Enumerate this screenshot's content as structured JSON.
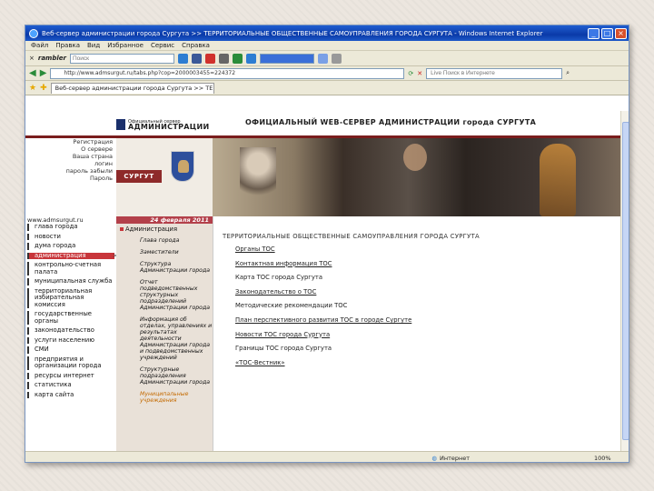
{
  "window": {
    "title": "Веб-сервер администрации города Сургута >> ТЕРРИТОРИАЛЬНЫЕ ОБЩЕСТВЕННЫЕ САМОУПРАВЛЕНИЯ ГОРОДА СУРГУТА - Windows Internet Explorer"
  },
  "menu": [
    "Файл",
    "Правка",
    "Вид",
    "Избранное",
    "Сервис",
    "Справка"
  ],
  "toolbar": {
    "brand": "rambler",
    "search_placeholder": "Поиск"
  },
  "address": {
    "url": "http://www.admsurgut.ru/tabs.php?cop=2000003455=224372",
    "live_search_placeholder": "Live Поиск в Интернете"
  },
  "tab": {
    "label": "Веб-сервер администрации города Сургута >> ТЕР..."
  },
  "site": {
    "logo_small": "Официальный сервер",
    "logo_big": "АДМИНИСТРАЦИИ",
    "title": "ОФИЦИАЛЬНЫЙ WEB-СЕРВЕР АДМИНИСТРАЦИИ города СУРГУТА",
    "city_label": "СУРГУТ",
    "url": "www.admsurgut.ru",
    "date": "24 февраля 2011",
    "login_lines": [
      "Регистрация",
      "О сервере",
      "Ваша страна",
      "логин",
      "пароль забыли",
      "Пароль"
    ]
  },
  "left_nav": [
    "глава города",
    "новости",
    "дума города",
    "администрация",
    "контрольно-счетная палата",
    "муниципальная служба",
    "территориальная избирательная комиссия",
    "государственные органы",
    "законодательство",
    "услуги населению",
    "СМИ",
    "предприятия и организации города",
    "ресурсы интернет",
    "статистика",
    "карта сайта"
  ],
  "subnav": {
    "header": "Администрация",
    "items": [
      "Глава города",
      "Заместители",
      "Структура Администрации города",
      "Отчет подведомственных структурных подразделений Администрации города",
      "Информация об отделах, управлениях и результатах деятельности Администрации города и подведомственных учреждений",
      "Структурные подразделения Администрации города",
      "Муниципальные учреждения"
    ]
  },
  "main": {
    "title": "ТЕРРИТОРИАЛЬНЫЕ ОБЩЕСТВЕННЫЕ САМОУПРАВЛЕНИЯ ГОРОДА СУРГУТА",
    "links": [
      "Органы ТОС",
      "Контактная информация ТОС",
      "Карта ТОС города Сургута",
      "Законодательство о ТОС",
      "Методические рекомендации ТОС",
      "План перспективного развития ТОС в городе Сургуте",
      "Новости ТОС города Сургута",
      "Границы ТОС города Сургута",
      "«ТОС-Вестник»"
    ]
  },
  "status": {
    "zone": "Интернет",
    "zoom": "100%"
  }
}
